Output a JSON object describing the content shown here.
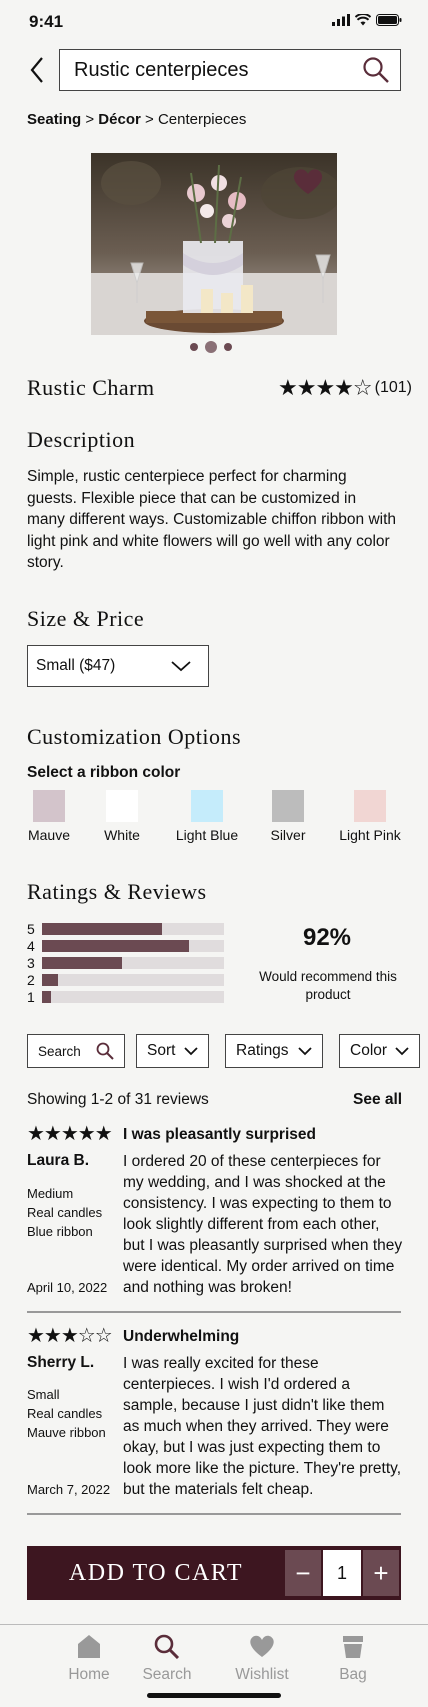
{
  "status": {
    "time": "9:41"
  },
  "search": {
    "value": "Rustic centerpieces"
  },
  "breadcrumb": {
    "items": [
      "Seating",
      "Décor",
      "Centerpieces"
    ],
    "sep": ">"
  },
  "product": {
    "name": "Rustic Charm",
    "rating_stars": "★★★★☆",
    "rating_value": 4,
    "rating_count": "(101)",
    "image_index": 2,
    "image_count": 3
  },
  "description": {
    "title": "Description",
    "text": "Simple, rustic centerpiece perfect for charming guests. Flexible piece that can be customized in many different ways. Customizable chiffon ribbon with light pink and white flowers will go well with any color story."
  },
  "size": {
    "title": "Size & Price",
    "selected": "Small ($47)"
  },
  "customization": {
    "title": "Customization Options",
    "label": "Select a ribbon color",
    "colors": [
      {
        "name": "Mauve",
        "hex": "#d3c4cb"
      },
      {
        "name": "White",
        "hex": "#ffffff"
      },
      {
        "name": "Light Blue",
        "hex": "#c5ecfb"
      },
      {
        "name": "Silver",
        "hex": "#bcbcbc"
      },
      {
        "name": "Light Pink",
        "hex": "#f1d6d3"
      }
    ]
  },
  "ratings": {
    "title": "Ratings & Reviews",
    "distribution": [
      {
        "star": "5",
        "fraction": 0.66
      },
      {
        "star": "4",
        "fraction": 0.81
      },
      {
        "star": "3",
        "fraction": 0.44
      },
      {
        "star": "2",
        "fraction": 0.09
      },
      {
        "star": "1",
        "fraction": 0.05
      }
    ],
    "recommend_pct": "92%",
    "recommend_text": "Would recommend this product"
  },
  "filters": {
    "search": "Search",
    "sort": "Sort",
    "ratings": "Ratings",
    "color": "Color"
  },
  "reviews_summary": {
    "showing": "Showing 1-2 of 31 reviews",
    "see_all": "See all"
  },
  "reviews": [
    {
      "stars": "★★★★★",
      "title": "I was pleasantly surprised",
      "author": "Laura B.",
      "meta": [
        "Medium",
        "Real candles",
        "Blue ribbon"
      ],
      "date": "April 10, 2022",
      "body": "I ordered 20 of these centerpieces for my wedding, and I was shocked at the consistency. I was expecting to them to look slightly different from each other, but I was pleasantly surprised when they were identical. My order arrived on time and nothing was broken!"
    },
    {
      "stars": "★★★☆☆",
      "title": "Underwhelming",
      "author": "Sherry L.",
      "meta": [
        "Small",
        "Real candles",
        "Mauve ribbon"
      ],
      "date": "March 7, 2022",
      "body": "I was really excited for these centerpieces. I wish I'd ordered a sample, because I just didn't like them as much when they arrived. They were okay, but I was just expecting them to look more like the picture. They're pretty, but the materials felt cheap."
    }
  ],
  "cart": {
    "label": "ADD TO CART",
    "minus": "−",
    "plus": "+",
    "qty": "1"
  },
  "tabs": {
    "home": "Home",
    "search": "Search",
    "wishlist": "Wishlist",
    "bag": "Bag"
  },
  "colors": {
    "accent": "#6b4a52",
    "cart_bg": "#3d1620",
    "active_tab": "#5a2d3a"
  }
}
